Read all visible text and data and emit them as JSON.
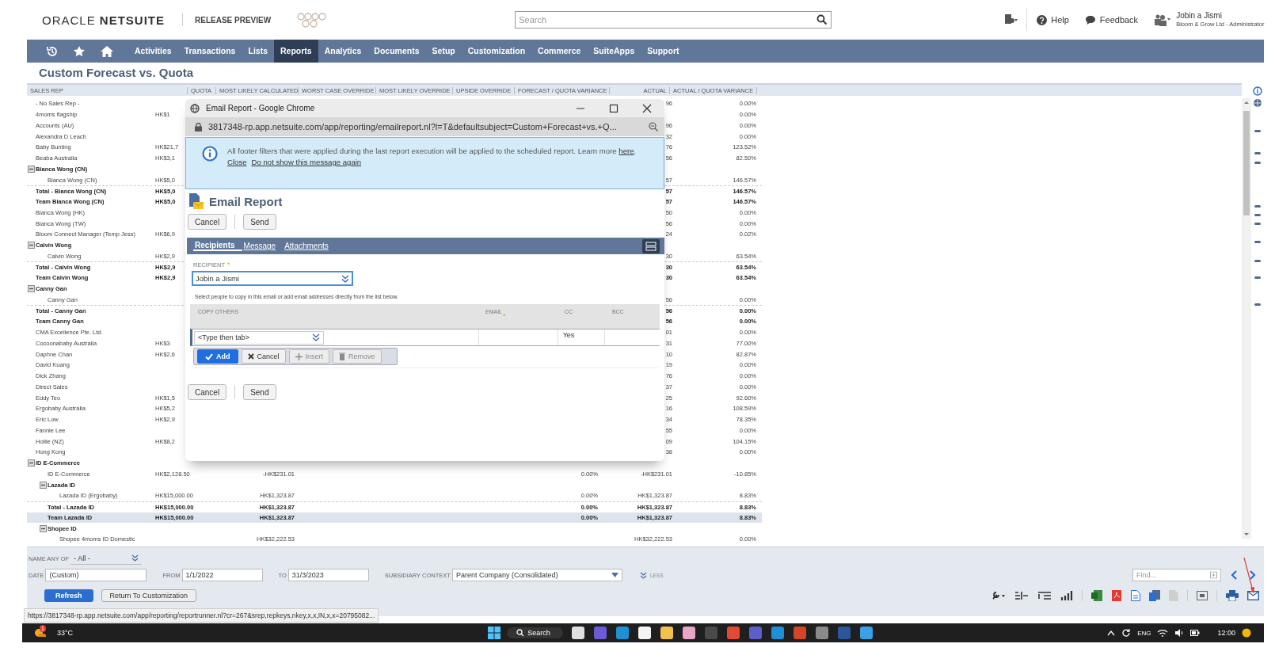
{
  "header": {
    "logo": "ORACLE **NETSUITE**",
    "release": "RELEASE PREVIEW",
    "search_placeholder": "Search",
    "help": "Help",
    "feedback": "Feedback",
    "user_name": "Jobin a Jismi",
    "user_role": "Bloom & Grow Ltd - Administrator"
  },
  "nav": [
    {
      "label": "Activities",
      "selected": false
    },
    {
      "label": "Transactions",
      "selected": false
    },
    {
      "label": "Lists",
      "selected": false
    },
    {
      "label": "Reports",
      "selected": true
    },
    {
      "label": "Analytics",
      "selected": false
    },
    {
      "label": "Documents",
      "selected": false
    },
    {
      "label": "Setup",
      "selected": false
    },
    {
      "label": "Customization",
      "selected": false
    },
    {
      "label": "Commerce",
      "selected": false
    },
    {
      "label": "SuiteApps",
      "selected": false
    },
    {
      "label": "Support",
      "selected": false
    }
  ],
  "page_title": "Custom Forecast vs. Quota",
  "table": {
    "columns": [
      "SALES REP",
      "QUOTA",
      "MOST LIKELY CALCULATED",
      "WORST CASE OVERRIDE",
      "MOST LIKELY OVERRIDE",
      "UPSIDE OVERRIDE",
      "FORECAST / QUOTA VARIANCE",
      "ACTUAL",
      "ACTUAL / QUOTA VARIANCE"
    ],
    "rows": [
      {
        "kind": "row",
        "name": "- No Sales Rep -",
        "actual": "96",
        "aq_var": "0.00%",
        "selected": false
      },
      {
        "kind": "row",
        "name": "4moms flagship",
        "quota": "HK$1",
        "aq_var": "0.00%",
        "selected": false
      },
      {
        "kind": "row",
        "name": "Accounts (AU)",
        "actual": "96",
        "aq_var": "0.00%",
        "selected": false
      },
      {
        "kind": "row",
        "name": "Alexandra D Leach",
        "actual": "32",
        "aq_var": "0.00%",
        "selected": false
      },
      {
        "kind": "row",
        "name": "Baby Bunting",
        "quota": "HK$21,7",
        "actual": "76",
        "aq_var": "123.52%",
        "selected": false
      },
      {
        "kind": "row",
        "name": "Beaba Australia",
        "quota": "HK$3,1",
        "actual": "56",
        "aq_var": "82.50%",
        "selected": false
      },
      {
        "kind": "group",
        "name": "Bianca Wong (CN)",
        "selected": false,
        "children": [
          {
            "kind": "row",
            "name": "Bianca Wong (CN)",
            "quota": "HK$5,0",
            "actual": "57",
            "aq_var": "146.57%",
            "selected": false
          }
        ]
      },
      {
        "kind": "subtotal",
        "name": "Total - Bianca Wong (CN)",
        "quota": "HK$5,0",
        "actual": "57",
        "aq_var": "146.57%",
        "selected": false
      },
      {
        "kind": "team",
        "name": "Team Bianca Wong (CN)",
        "quota": "HK$5,0",
        "actual": "57",
        "aq_var": "146.57%",
        "selected": false
      },
      {
        "kind": "row",
        "name": "Bianca Wong (HK)",
        "actual": "50",
        "aq_var": "0.00%",
        "selected": false
      },
      {
        "kind": "row",
        "name": "Bianca Wong (TW)",
        "actual": "56",
        "aq_var": "0.00%",
        "selected": false
      },
      {
        "kind": "row",
        "name": "Bloom Connect Manager (Temp Jess)",
        "quota": "HK$6,9",
        "actual": "24",
        "aq_var": "0.02%",
        "selected": false
      },
      {
        "kind": "group",
        "name": "Calvin Wong",
        "selected": false,
        "children": [
          {
            "kind": "row",
            "name": "Calvin Wong",
            "quota": "HK$2,9",
            "actual": "30",
            "aq_var": "63.54%",
            "selected": false
          }
        ]
      },
      {
        "kind": "subtotal",
        "name": "Total - Calvin Wong",
        "quota": "HK$2,9",
        "actual": "30",
        "aq_var": "63.54%",
        "selected": false
      },
      {
        "kind": "team",
        "name": "Team Calvin Wong",
        "quota": "HK$2,9",
        "actual": "30",
        "aq_var": "63.54%",
        "selected": false
      },
      {
        "kind": "group",
        "name": "Canny Gan",
        "selected": false,
        "children": [
          {
            "kind": "row",
            "name": "Canny Gan",
            "actual": "56",
            "aq_var": "0.00%",
            "selected": false
          }
        ]
      },
      {
        "kind": "subtotal",
        "name": "Total - Canny Gan",
        "actual": "56",
        "aq_var": "0.00%",
        "selected": false
      },
      {
        "kind": "team",
        "name": "Team Canny Gan",
        "actual": "56",
        "aq_var": "0.00%",
        "selected": false
      },
      {
        "kind": "row",
        "name": "CMA Excellence Pte. Ltd.",
        "actual": "01",
        "aq_var": "0.00%",
        "selected": false
      },
      {
        "kind": "row",
        "name": "Cocoonababy Australia",
        "quota": "HK$3",
        "actual": "31",
        "aq_var": "77.00%",
        "selected": false
      },
      {
        "kind": "row",
        "name": "Daphne Chan",
        "quota": "HK$2,6",
        "actual": "10",
        "aq_var": "82.87%",
        "selected": false
      },
      {
        "kind": "row",
        "name": "David Kuang",
        "actual": "19",
        "aq_var": "0.00%",
        "selected": false
      },
      {
        "kind": "row",
        "name": "Dick Zhang",
        "actual": "76",
        "aq_var": "0.00%",
        "selected": false
      },
      {
        "kind": "row",
        "name": "Direct Sales",
        "actual": "37",
        "aq_var": "0.00%",
        "selected": false
      },
      {
        "kind": "row",
        "name": "Eddy Teo",
        "quota": "HK$1,5",
        "actual": "25",
        "aq_var": "92.60%",
        "selected": false
      },
      {
        "kind": "row",
        "name": "Ergobaby Australia",
        "quota": "HK$5,2",
        "actual": "16",
        "aq_var": "108.59%",
        "selected": false
      },
      {
        "kind": "row",
        "name": "Eric Low",
        "quota": "HK$2,9",
        "actual": "34",
        "aq_var": "78.35%",
        "selected": false
      },
      {
        "kind": "row",
        "name": "Fannie Lee",
        "actual": "55",
        "aq_var": "0.00%",
        "selected": false
      },
      {
        "kind": "row",
        "name": "Hollie (NZ)",
        "quota": "HK$8,2",
        "actual": "09",
        "aq_var": "104.15%",
        "selected": false
      },
      {
        "kind": "row",
        "name": "Hong Kong",
        "actual": "38",
        "aq_var": "0.00%",
        "selected": false
      },
      {
        "kind": "group",
        "name": "ID E-Commerce",
        "selected": false,
        "children": [
          {
            "kind": "row",
            "name": "ID E-Commerce",
            "quota": "HK$2,128.50",
            "calc": "-HK$231.01",
            "fq_var": "0.00%",
            "actual": "-HK$231.01",
            "aq_var": "-10.85%",
            "selected": false
          },
          {
            "kind": "group",
            "name": "Lazada ID",
            "selected": false,
            "children": [
              {
                "kind": "row",
                "name": "Lazada ID (Ergobaby)",
                "quota": "HK$15,000.00",
                "calc": "HK$1,323.87",
                "fq_var": "0.00%",
                "actual": "HK$1,323.87",
                "aq_var": "8.83%",
                "selected": false
              }
            ]
          },
          {
            "kind": "subtotal",
            "name": "Total - Lazada ID",
            "quota": "HK$15,000.00",
            "calc": "HK$1,323.87",
            "fq_var": "0.00%",
            "actual": "HK$1,323.87",
            "aq_var": "8.83%",
            "selected": false
          },
          {
            "kind": "team",
            "name": "Team Lazada ID",
            "quota": "HK$15,000.00",
            "calc": "HK$1,323.87",
            "fq_var": "0.00%",
            "actual": "HK$1,323.87",
            "aq_var": "8.83%",
            "selected": true
          },
          {
            "kind": "group",
            "name": "Shopee ID",
            "selected": false,
            "children": [
              {
                "kind": "row",
                "name": "Shopee 4moms ID Domestic",
                "calc": "HK$32,222.53",
                "actual": "HK$32,222.53",
                "aq_var": "0.00%",
                "selected": false
              }
            ]
          }
        ]
      }
    ]
  },
  "filters": {
    "name_any_of": {
      "label": "NAME ANY OF",
      "value": "- All -"
    },
    "date": {
      "label": "DATE",
      "value": "(Custom)"
    },
    "from": {
      "label": "FROM",
      "value": "1/1/2022"
    },
    "to": {
      "label": "TO",
      "value": "31/3/2023"
    },
    "subsidiary": {
      "label": "SUBSIDIARY CONTEXT",
      "value": "Parent Company (Consolidated)"
    },
    "less": "LESS",
    "find_placeholder": "Find..."
  },
  "buttons": {
    "refresh": "Refresh",
    "return": "Return To Customization"
  },
  "status_url": "https://3817348-rp.app.netsuite.com/app/reporting/reportrunner.nl?cr=267&srep,repkeys,nkey,x,x,IN,x,x=20795082...",
  "dialog": {
    "window_title": "Email Report - Google Chrome",
    "url": "3817348-rp.app.netsuite.com/app/reporting/emailreport.nl?l=T&defaultsubject=Custom+Forecast+vs.+Q...",
    "notice": {
      "text": "All footer filters that were applied during the last report execution will be applied to the scheduled report. Learn more",
      "link": "here",
      "end": ".",
      "close": "Close",
      "dismiss": "Do not show this message again"
    },
    "title": "Email Report",
    "top_buttons": [
      "Cancel",
      "Send"
    ],
    "tabs": [
      {
        "label": "Recipients",
        "selected": true
      },
      {
        "label": "Message",
        "selected": false
      },
      {
        "label": "Attachments",
        "selected": false
      }
    ],
    "recipient": {
      "label": "RECIPIENT",
      "required_mark": "*",
      "value": "Jobin a Jismi"
    },
    "hint": "Select people to copy in this email or add email addresses directly from the list below.",
    "copy_table": {
      "columns": [
        {
          "label": "COPY OTHERS"
        },
        {
          "label": "EMAIL",
          "required_mark": "*"
        },
        {
          "label": "CC"
        },
        {
          "label": "BCC"
        }
      ],
      "row": {
        "placeholder": "<Type then tab>",
        "cc": "Yes"
      },
      "actions": [
        {
          "label": "Add",
          "kind": "add",
          "disabled": false
        },
        {
          "label": "Cancel",
          "kind": "cancel",
          "disabled": false
        },
        {
          "label": "Insert",
          "kind": "insert",
          "disabled": true
        },
        {
          "label": "Remove",
          "kind": "remove",
          "disabled": true
        }
      ]
    },
    "bottom_buttons": [
      "Cancel",
      "Send"
    ]
  },
  "taskbar": {
    "weather_badge": "1",
    "temperature": "33°C",
    "search": "Search",
    "language": "ENG",
    "time": "12:00"
  }
}
